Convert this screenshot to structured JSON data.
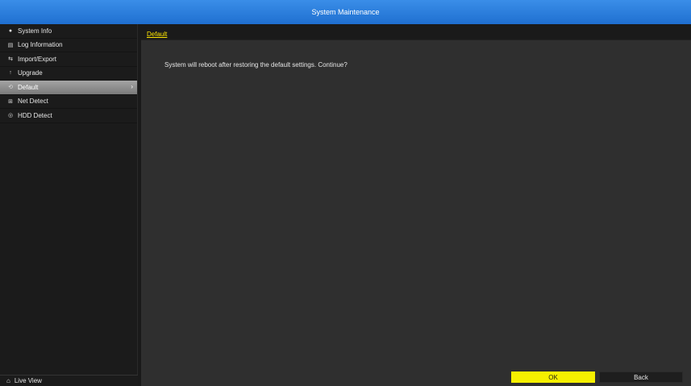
{
  "window": {
    "title": "System Maintenance"
  },
  "sidebar": {
    "items": [
      {
        "label": "System Info",
        "icon": "info-icon"
      },
      {
        "label": "Log Information",
        "icon": "log-icon"
      },
      {
        "label": "Import/Export",
        "icon": "import-export-icon"
      },
      {
        "label": "Upgrade",
        "icon": "upgrade-icon"
      },
      {
        "label": "Default",
        "icon": "default-icon",
        "active": true
      },
      {
        "label": "Net Detect",
        "icon": "network-icon"
      },
      {
        "label": "HDD Detect",
        "icon": "hdd-icon"
      }
    ],
    "live_view_label": "Live View"
  },
  "main": {
    "tab_label": "Default",
    "message": "System will reboot after restoring the default settings. Continue?",
    "ok_label": "OK",
    "back_label": "Back"
  },
  "colors": {
    "title_bar": "#2a7fe0",
    "active_item": "#8f8f8f",
    "ok_button": "#f6f000",
    "tab_text": "#ffe600"
  }
}
